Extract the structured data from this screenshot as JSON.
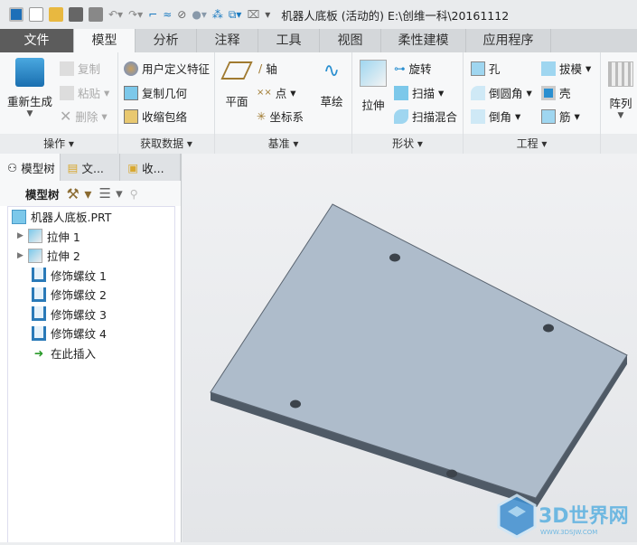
{
  "window": {
    "title": "机器人底板 (活动的) E:\\创维一科\\20161112"
  },
  "tabs": [
    {
      "label": "文件"
    },
    {
      "label": "模型"
    },
    {
      "label": "分析"
    },
    {
      "label": "注释"
    },
    {
      "label": "工具"
    },
    {
      "label": "视图"
    },
    {
      "label": "柔性建模"
    },
    {
      "label": "应用程序"
    }
  ],
  "ribbon": {
    "operations": {
      "label": "操作",
      "regenerate": "重新生成",
      "copy": "复制",
      "paste": "粘贴",
      "delete": "删除"
    },
    "get_data": {
      "label": "获取数据",
      "udf": "用户定义特征",
      "copy_geom": "复制几何",
      "shrinkwrap": "收缩包络"
    },
    "datum": {
      "label": "基准",
      "plane": "平面",
      "axis": "轴",
      "point": "点",
      "csys": "坐标系",
      "sketch": "草绘"
    },
    "shapes": {
      "label": "形状",
      "extrude": "拉伸",
      "revolve": "旋转",
      "sweep": "扫描",
      "swept_blend": "扫描混合"
    },
    "engineering": {
      "label": "工程",
      "hole": "孔",
      "round": "倒圆角",
      "chamfer": "倒角",
      "draft": "拔模",
      "shell": "壳",
      "rib": "筋"
    },
    "pattern": {
      "label": "阵列"
    }
  },
  "panel": {
    "tabs": [
      {
        "label": "模型树"
      },
      {
        "label": "文..."
      },
      {
        "label": "收..."
      }
    ],
    "toolbar_label": "模型树",
    "tree": [
      {
        "label": "机器人底板.PRT",
        "icon": "part-icon"
      },
      {
        "label": "拉伸 1",
        "icon": "extrude-icon",
        "expandable": true
      },
      {
        "label": "拉伸 2",
        "icon": "extrude-icon",
        "expandable": true
      },
      {
        "label": "修饰螺纹 1",
        "icon": "thread-icon"
      },
      {
        "label": "修饰螺纹 2",
        "icon": "thread-icon"
      },
      {
        "label": "修饰螺纹 3",
        "icon": "thread-icon"
      },
      {
        "label": "修饰螺纹 4",
        "icon": "thread-icon"
      },
      {
        "label": "在此插入",
        "icon": "insert-arrow-icon"
      }
    ]
  },
  "watermark": {
    "text": "3D世界网",
    "url_text": "WWW.3DSJW.COM"
  }
}
